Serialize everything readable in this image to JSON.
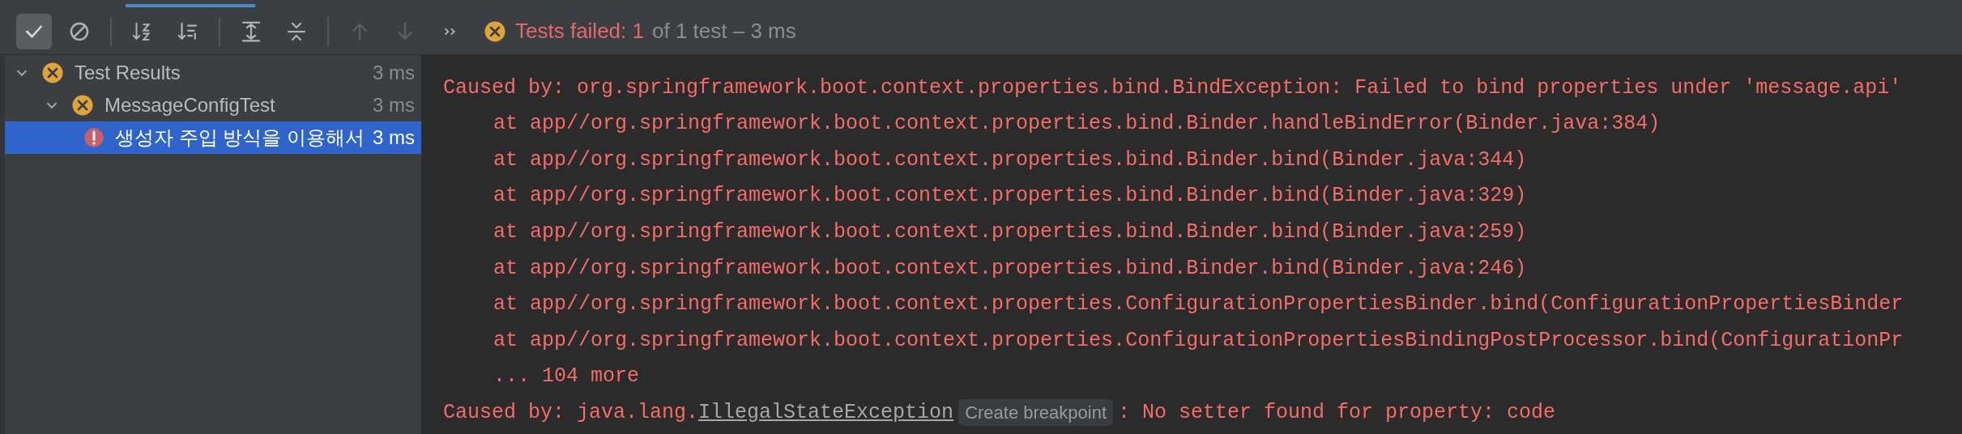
{
  "toolbar": {
    "buttons": [
      {
        "kind": "check",
        "selected": true,
        "disabled": false
      },
      {
        "kind": "stop",
        "selected": false,
        "disabled": false
      },
      {
        "kind": "sort_alpha",
        "selected": false,
        "disabled": false
      },
      {
        "kind": "sort_duration",
        "selected": false,
        "disabled": false
      },
      {
        "kind": "expand",
        "selected": false,
        "disabled": false
      },
      {
        "kind": "collapse",
        "selected": false,
        "disabled": false
      },
      {
        "kind": "up",
        "selected": false,
        "disabled": true
      },
      {
        "kind": "down",
        "selected": false,
        "disabled": true
      },
      {
        "kind": "more",
        "selected": false,
        "disabled": false
      }
    ],
    "status": {
      "failed": "Tests failed: 1",
      "rest": "of 1 test – 3 ms"
    }
  },
  "tree": [
    {
      "label": "Test Results",
      "time": "3 ms",
      "kind": "failed",
      "expanded": true,
      "selected": false,
      "children": [
        {
          "label": "MessageConfigTest",
          "time": "3 ms",
          "kind": "failed",
          "expanded": true,
          "selected": false,
          "children": [
            {
              "label": "생성자 주입 방식을 이용해서",
              "time": "3 ms",
              "kind": "error",
              "selected": true
            }
          ]
        }
      ]
    }
  ],
  "console": {
    "lines": [
      {
        "kind": "caused",
        "text": "Caused by: org.springframework.boot.context.properties.bind.BindException: Failed to bind properties under 'message.api'"
      },
      {
        "kind": "at",
        "text": "at app//org.springframework.boot.context.properties.bind.Binder.handleBindError(Binder.java:384)"
      },
      {
        "kind": "at",
        "text": "at app//org.springframework.boot.context.properties.bind.Binder.bind(Binder.java:344)"
      },
      {
        "kind": "at",
        "text": "at app//org.springframework.boot.context.properties.bind.Binder.bind(Binder.java:329)"
      },
      {
        "kind": "at",
        "text": "at app//org.springframework.boot.context.properties.bind.Binder.bind(Binder.java:259)"
      },
      {
        "kind": "at",
        "text": "at app//org.springframework.boot.context.properties.bind.Binder.bind(Binder.java:246)"
      },
      {
        "kind": "at",
        "text": "at app//org.springframework.boot.context.properties.ConfigurationPropertiesBinder.bind(ConfigurationPropertiesBinder"
      },
      {
        "kind": "at",
        "text": "at app//org.springframework.boot.context.properties.ConfigurationPropertiesBindingPostProcessor.bind(ConfigurationPr"
      },
      {
        "kind": "at",
        "text": "... 104 more"
      },
      {
        "kind": "link",
        "prefix": "Caused by: java.lang.",
        "link": "IllegalStateException",
        "hint": "Create breakpoint",
        "suffix": ": No setter found for property: code"
      }
    ]
  }
}
